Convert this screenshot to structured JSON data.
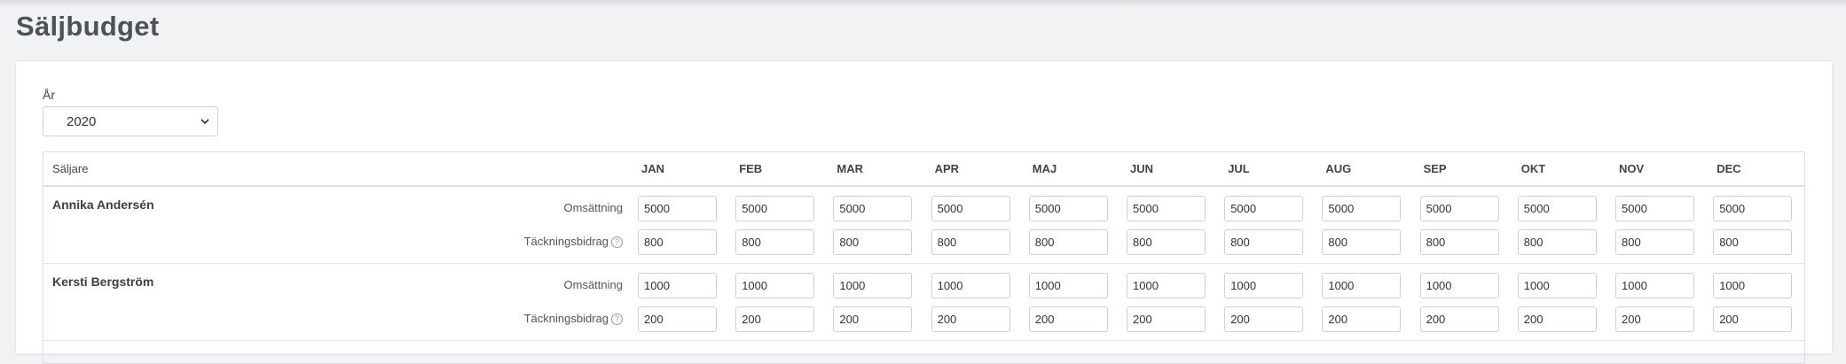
{
  "page": {
    "title": "Säljbudget"
  },
  "filter": {
    "year_label": "År",
    "year_value": "2020"
  },
  "table": {
    "seller_header": "Säljare",
    "months": [
      "JAN",
      "FEB",
      "MAR",
      "APR",
      "MAJ",
      "JUN",
      "JUL",
      "AUG",
      "SEP",
      "OKT",
      "NOV",
      "DEC"
    ],
    "rows": [
      {
        "seller": "Annika Andersén",
        "omsattning_label": "Omsättning",
        "tackning_label": "Täckningsbidrag",
        "omsattning": [
          "5000",
          "5000",
          "5000",
          "5000",
          "5000",
          "5000",
          "5000",
          "5000",
          "5000",
          "5000",
          "5000",
          "5000"
        ],
        "tackning": [
          "800",
          "800",
          "800",
          "800",
          "800",
          "800",
          "800",
          "800",
          "800",
          "800",
          "800",
          "800"
        ]
      },
      {
        "seller": "Kersti Bergström",
        "omsattning_label": "Omsättning",
        "tackning_label": "Täckningsbidrag",
        "omsattning": [
          "1000",
          "1000",
          "1000",
          "1000",
          "1000",
          "1000",
          "1000",
          "1000",
          "1000",
          "1000",
          "1000",
          "1000"
        ],
        "tackning": [
          "200",
          "200",
          "200",
          "200",
          "200",
          "200",
          "200",
          "200",
          "200",
          "200",
          "200",
          "200"
        ]
      }
    ]
  },
  "icons": {
    "help": "help-circle-icon",
    "chevron": "chevron-down-icon"
  }
}
